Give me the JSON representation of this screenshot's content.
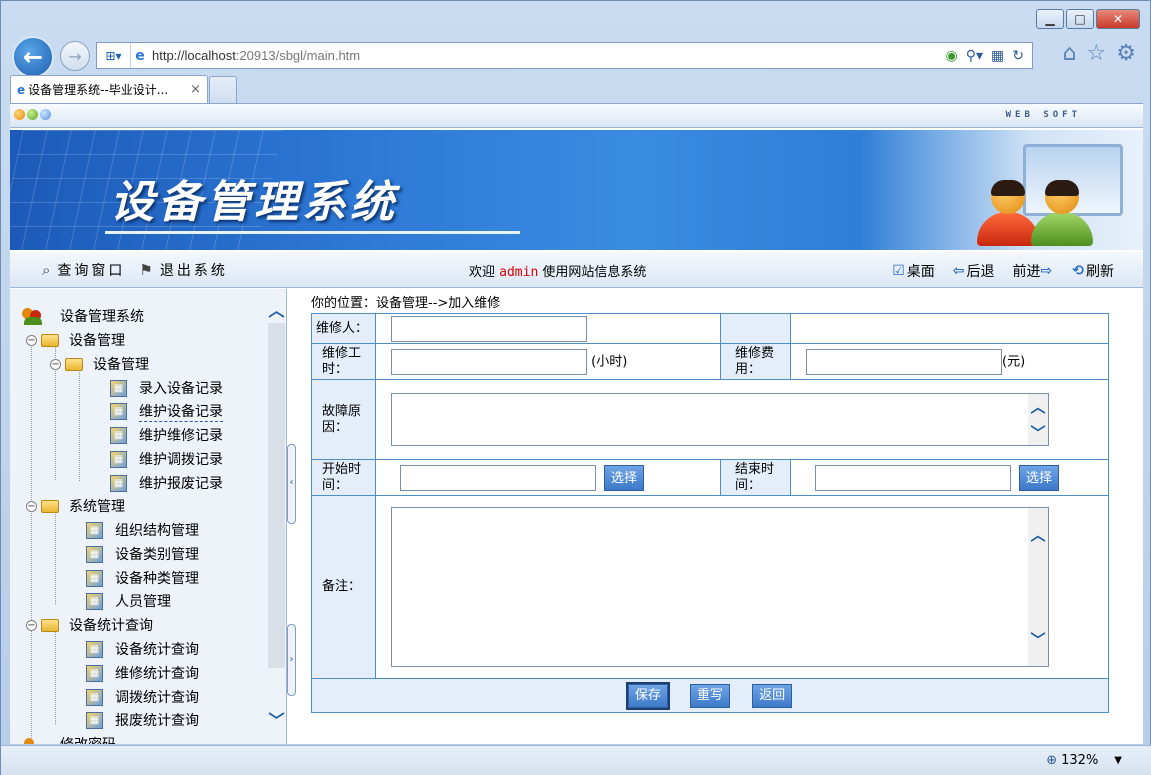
{
  "browser": {
    "url": "http://localhost:20913/sbgl/main.htm",
    "url_host": "http://localhost",
    "url_rest": ":20913/sbgl/main.htm",
    "tab_title": "设备管理系统--毕业设计...",
    "tab_close": "×",
    "zoom": "132%",
    "min_label": "▁",
    "max_label": "□",
    "close_label": "✕"
  },
  "page": {
    "websoft": "WEB SOFT",
    "banner_title": "设备管理系统",
    "toolbar": {
      "query_window": "查询窗口",
      "logout": "退出系统",
      "welcome_pre": "欢迎 ",
      "welcome_user": "admin",
      "welcome_post": " 使用网站信息系统",
      "desktop": "桌面",
      "back": "后退",
      "forward": "前进",
      "refresh": "刷新"
    },
    "tree": {
      "root": "设备管理系统",
      "group1": "设备管理",
      "group1_sub": "设备管理",
      "items1": [
        "录入设备记录",
        "维护设备记录",
        "维护维修记录",
        "维护调拨记录",
        "维护报废记录"
      ],
      "group2": "系统管理",
      "items2": [
        "组织结构管理",
        "设备类别管理",
        "设备种类管理",
        "人员管理"
      ],
      "group3": "设备统计查询",
      "items3": [
        "设备统计查询",
        "维修统计查询",
        "调拨统计查询",
        "报废统计查询"
      ],
      "group4_partial": "修改密码"
    },
    "location": "你的位置：设备管理-->加入维修",
    "form": {
      "repairer_label": "维修人：",
      "hours_label_1": "维修工",
      "hours_label_2": "时：",
      "hours_unit": "(小时)",
      "cost_label_1": "维修费",
      "cost_label_2": "用：",
      "cost_unit": "(元)",
      "fault_label_1": "故障原",
      "fault_label_2": "因：",
      "start_label_1": "开始时",
      "start_label_2": "间：",
      "end_label_1": "结束时",
      "end_label_2": "间：",
      "pick": "选择",
      "remark_label": "备注：",
      "save": "保存",
      "reset": "重写",
      "back": "返回"
    }
  }
}
